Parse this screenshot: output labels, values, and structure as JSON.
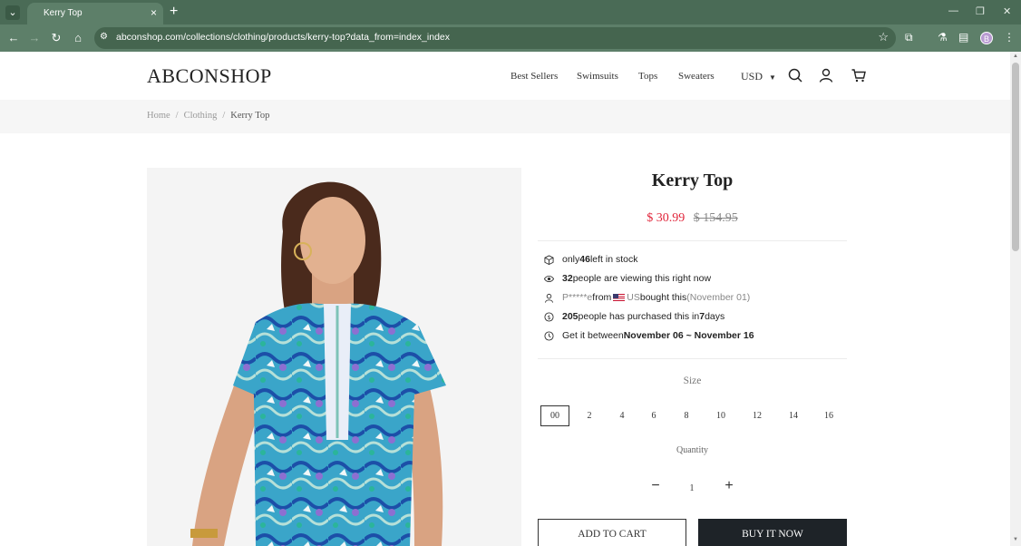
{
  "browser": {
    "tab_title": "Kerry Top",
    "url": "abconshop.com/collections/clothing/products/kerry-top?data_from=index_index",
    "profile_initial": "B"
  },
  "header": {
    "logo": "ABCONSHOP",
    "menu": [
      "Best Sellers",
      "Swimsuits",
      "Tops",
      "Sweaters"
    ],
    "currency": "USD"
  },
  "breadcrumb": {
    "items": [
      "Home",
      "Clothing",
      "Kerry Top"
    ],
    "separator": "/"
  },
  "product": {
    "title": "Kerry Top",
    "price": "$ 30.99",
    "compare_price": "$ 154.95",
    "stock": {
      "pre": "only ",
      "count": "46",
      "post": " left in stock"
    },
    "viewing": {
      "count": "32",
      "post": " people are viewing this right now"
    },
    "recent": {
      "buyer": "P*****e",
      "from": " from ",
      "country": "US",
      "bought": " bought this ",
      "date": "(November 01)"
    },
    "purchased": {
      "count": "205",
      "mid": " people has purchased this in ",
      "days": "7",
      "post": " days"
    },
    "delivery": {
      "pre": "Get it between ",
      "range": "November 06 ~ November 16"
    },
    "size_label": "Size",
    "sizes": [
      "00",
      "2",
      "4",
      "6",
      "8",
      "10",
      "12",
      "14",
      "16"
    ],
    "selected_size": "00",
    "quantity_label": "Quantity",
    "quantity": "1",
    "add_to_cart": "ADD TO CART",
    "buy_now": "BUY IT NOW"
  },
  "colors": {
    "browser_frame": "#4a6b56",
    "sale_price": "#e0243a",
    "buy_button": "#1e2328"
  }
}
